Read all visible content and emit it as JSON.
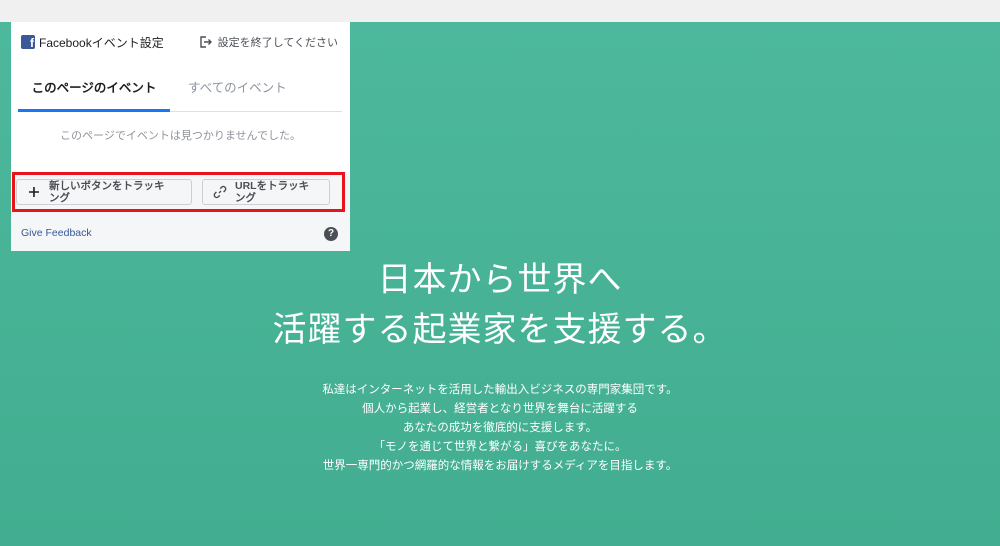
{
  "fb_panel": {
    "title": "Facebookイベント設定",
    "exit_label": "設定を終了してください",
    "tabs": [
      {
        "label": "このページのイベント",
        "active": true
      },
      {
        "label": "すべてのイベント",
        "active": false
      }
    ],
    "empty_message": "このページでイベントは見つかりませんでした。",
    "buttons": {
      "new_button": "新しいボタンをトラッキング",
      "url": "URLをトラッキング"
    },
    "feedback": "Give Feedback",
    "help_glyph": "?",
    "icons": {
      "logo": "facebook-logo-icon",
      "exit": "exit-icon",
      "plus": "plus-icon",
      "link": "link-icon",
      "help": "help-icon"
    }
  },
  "hero": {
    "headline_1": "日本から世界へ",
    "headline_2": "活躍する起業家を支援する。",
    "lines": [
      "私達はインターネットを活用した輸出入ビジネスの専門家集団です。",
      "個人から起業し、経営者となり世界を舞台に活躍する",
      "あなたの成功を徹底的に支援します。",
      "「モノを通じて世界と繋がる」喜びをあなたに。",
      "世界一専門的かつ網羅的な情報をお届けするメディアを目指します。"
    ]
  },
  "colors": {
    "hero_bg": "#47b295",
    "fb_blue": "#1877f2",
    "highlight": "#e8141b"
  }
}
